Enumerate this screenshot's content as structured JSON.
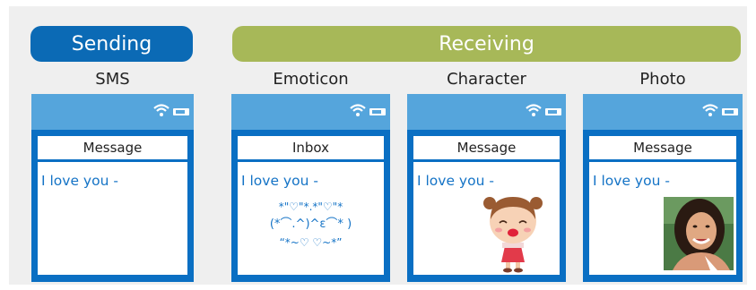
{
  "groups": {
    "sending": "Sending",
    "receiving": "Receiving"
  },
  "columns": [
    {
      "label": "SMS",
      "header": "Message",
      "message": "I love you -"
    },
    {
      "label": "Emoticon",
      "header": "Inbox",
      "message": "I love you -",
      "emoticon_lines": [
        "*\"♡\"*.*\"♡\"*",
        "(*⌒.^)^ε⌒* )",
        "“*~♡ ♡~*”"
      ]
    },
    {
      "label": "Character",
      "header": "Message",
      "message": "I love you -"
    },
    {
      "label": "Photo",
      "header": "Message",
      "message": "I love you -"
    }
  ],
  "colors": {
    "sending_pill": "#0b6ab5",
    "receiving_pill": "#a7b858",
    "phone_frame": "#0a6fc3",
    "status_bar": "#55a5dc",
    "message_text": "#1473c6"
  },
  "icons": [
    "wifi-icon",
    "battery-icon"
  ]
}
